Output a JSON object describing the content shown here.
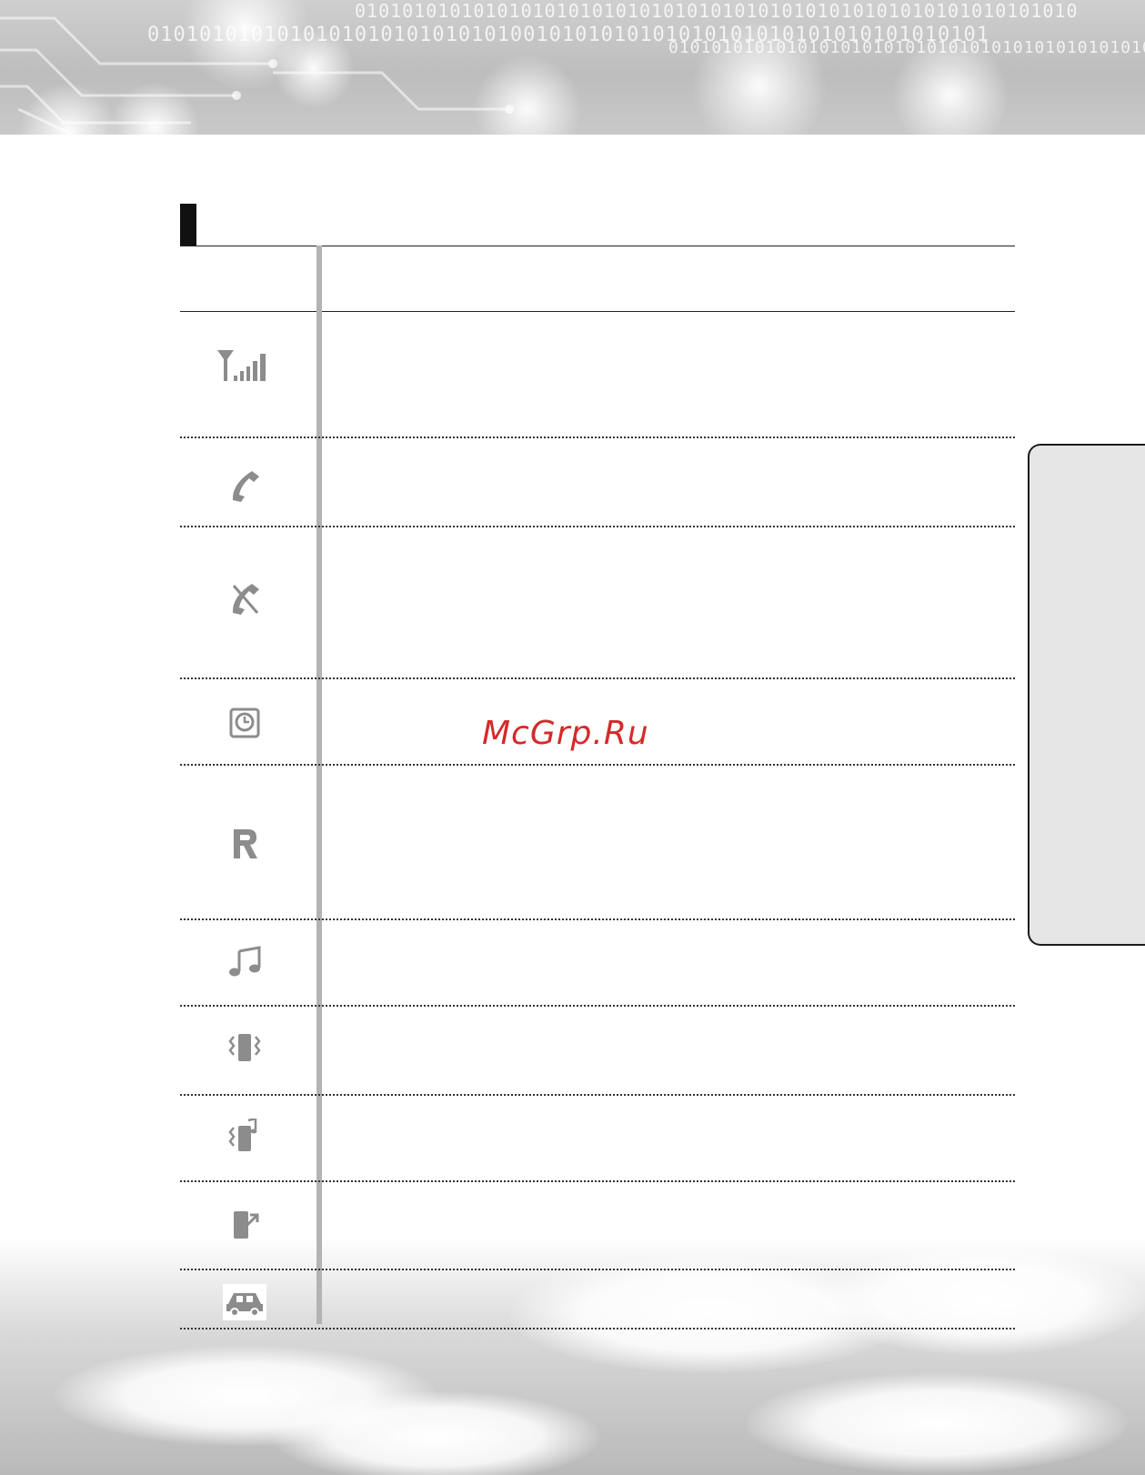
{
  "watermark": {
    "text": "McGrp.Ru",
    "color": "#d42a2a"
  },
  "banner": {
    "binary_line_1": "0101010101010101010101010101010101010101010101010101010101010",
    "binary_line_2": "01010101010101010101010101010010101010101010101010101010101010101",
    "binary_line_3": "0101010101010101010101010101010101010101010101"
  },
  "icon_rows": [
    {
      "icon": "signal-strength-icon"
    },
    {
      "icon": "call-active-icon"
    },
    {
      "icon": "no-service-icon"
    },
    {
      "icon": "alarm-clock-icon"
    },
    {
      "icon": "roaming-icon"
    },
    {
      "icon": "ringer-melody-icon"
    },
    {
      "icon": "vibrate-icon"
    },
    {
      "icon": "vibrate-and-ring-icon"
    },
    {
      "icon": "silent-mode-icon"
    },
    {
      "icon": "car-kit-icon"
    }
  ],
  "colors": {
    "icon_gray": "#8c8c8c",
    "divider_gray": "#b3b3b3",
    "side_tab_fill": "#e6e6e6"
  }
}
